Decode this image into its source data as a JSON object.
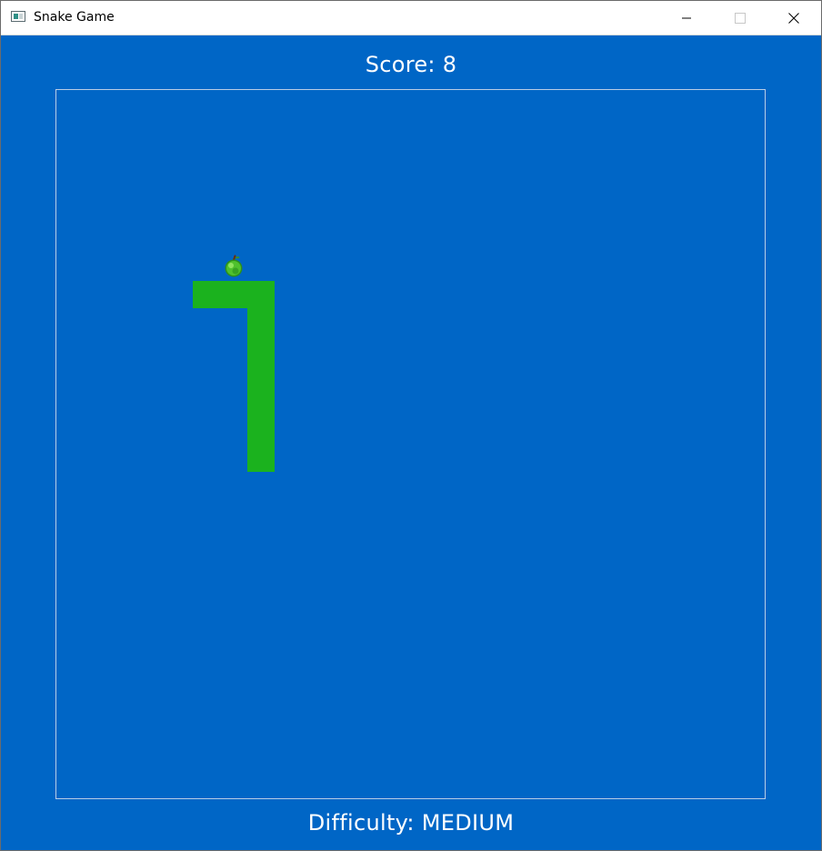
{
  "window": {
    "title": "Snake Game",
    "app_icon": "window-app-icon",
    "controls": {
      "minimize_icon": "minimize-icon",
      "maximize_icon": "maximize-icon",
      "close_icon": "close-icon"
    }
  },
  "game": {
    "score_text": "Score: 8",
    "difficulty_text": "Difficulty: MEDIUM",
    "colors": {
      "background": "#0066c6",
      "snake": "#1bb21e",
      "board_border": "#b9cde6",
      "text": "#ffffff"
    },
    "food_icon": "apple-icon"
  }
}
